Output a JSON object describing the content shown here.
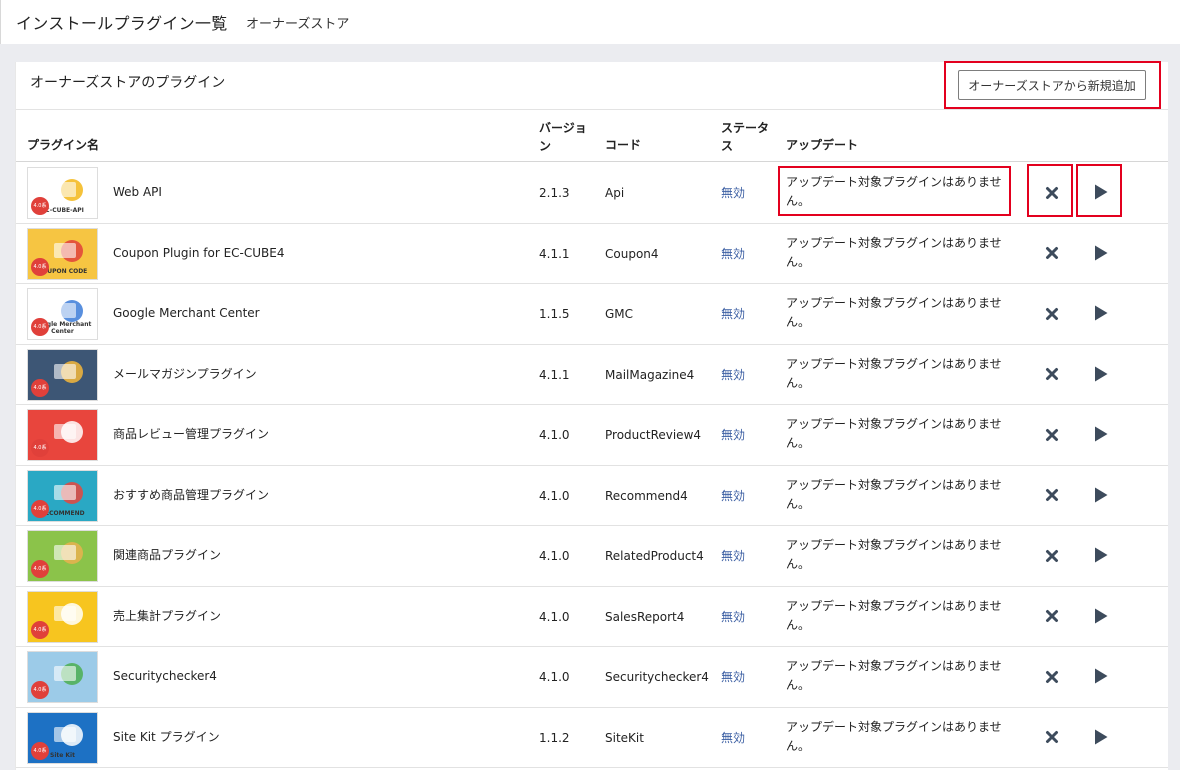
{
  "page": {
    "title": "インストールプラグイン一覧",
    "subtitle": "オーナーズストア"
  },
  "card": {
    "title": "オーナーズストアのプラグイン",
    "add_button": "オーナーズストアから新規追加"
  },
  "table": {
    "headers": {
      "name": "プラグイン名",
      "version": "バージョン",
      "code": "コード",
      "status": "ステータス",
      "update": "アップデート"
    },
    "rows": [
      {
        "name": "Web API",
        "version": "2.1.3",
        "code": "Api",
        "status": "無効",
        "update": "アップデート対象プラグインはありません。"
      },
      {
        "name": "Coupon Plugin for EC-CUBE4",
        "version": "4.1.1",
        "code": "Coupon4",
        "status": "無効",
        "update": "アップデート対象プラグインはありません。"
      },
      {
        "name": "Google Merchant Center",
        "version": "1.1.5",
        "code": "GMC",
        "status": "無効",
        "update": "アップデート対象プラグインはありません。"
      },
      {
        "name": "メールマガジンプラグイン",
        "version": "4.1.1",
        "code": "MailMagazine4",
        "status": "無効",
        "update": "アップデート対象プラグインはありません。"
      },
      {
        "name": "商品レビュー管理プラグイン",
        "version": "4.1.0",
        "code": "ProductReview4",
        "status": "無効",
        "update": "アップデート対象プラグインはありません。"
      },
      {
        "name": "おすすめ商品管理プラグイン",
        "version": "4.1.0",
        "code": "Recommend4",
        "status": "無効",
        "update": "アップデート対象プラグインはありません。"
      },
      {
        "name": "関連商品プラグイン",
        "version": "4.1.0",
        "code": "RelatedProduct4",
        "status": "無効",
        "update": "アップデート対象プラグインはありません。"
      },
      {
        "name": "売上集計プラグイン",
        "version": "4.1.0",
        "code": "SalesReport4",
        "status": "無効",
        "update": "アップデート対象プラグインはありません。"
      },
      {
        "name": "Securitychecker4",
        "version": "4.1.0",
        "code": "Securitychecker4",
        "status": "無効",
        "update": "アップデート対象プラグインはありません。"
      },
      {
        "name": "Site Kit プラグイン",
        "version": "1.1.2",
        "code": "SiteKit",
        "status": "無効",
        "update": "アップデート対象プラグインはありません。"
      }
    ]
  },
  "thumbnails": [
    {
      "text": "EC-CUBE-API",
      "bg": "#ffffff",
      "accent": "#f3b718"
    },
    {
      "text": "COUPON CODE",
      "bg": "#f6c542",
      "accent": "#e0403a"
    },
    {
      "text": "Google Merchant Center",
      "bg": "#ffffff",
      "accent": "#3b7bd8"
    },
    {
      "text": "",
      "bg": "#3d5675",
      "accent": "#f4b73b"
    },
    {
      "text": "",
      "bg": "#e8453d",
      "accent": "#ffffff"
    },
    {
      "text": "RECOMMEND",
      "bg": "#2aa8c4",
      "accent": "#e8453d"
    },
    {
      "text": "",
      "bg": "#8bc34a",
      "accent": "#e9b24f"
    },
    {
      "text": "",
      "bg": "#f7c51f",
      "accent": "#ffffff"
    },
    {
      "text": "",
      "bg": "#9ccbe8",
      "accent": "#4caf50"
    },
    {
      "text": "Site Kit",
      "bg": "#1d71c4",
      "accent": "#ffffff"
    }
  ],
  "badge_text": "4.0系 対応",
  "colors": {
    "highlight": "#e3001e",
    "status_link": "#3c5fa3",
    "action_icon": "#3d4b5c"
  },
  "icons": {
    "uninstall": "close-icon",
    "enable": "play-icon"
  }
}
